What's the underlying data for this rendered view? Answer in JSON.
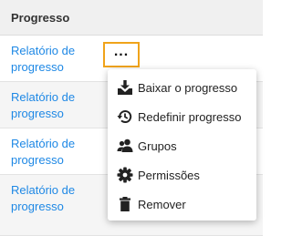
{
  "table": {
    "header": "Progresso",
    "rows": [
      {
        "link": "Relatório de progresso"
      },
      {
        "link": "Relatório de progresso"
      },
      {
        "link": "Relatório de progresso"
      },
      {
        "link": "Relatório de progresso"
      }
    ]
  },
  "actions_button": {
    "label": "..."
  },
  "menu": {
    "items": [
      {
        "label": "Baixar o progresso",
        "icon": "download-tray-icon"
      },
      {
        "label": "Redefinir progresso",
        "icon": "history-icon"
      },
      {
        "label": "Grupos",
        "icon": "users-icon"
      },
      {
        "label": "Permissões",
        "icon": "cog-icon"
      },
      {
        "label": "Remover",
        "icon": "trash-icon"
      }
    ]
  },
  "colors": {
    "link": "#1e88e5",
    "highlight": "#f0a31a",
    "header_bg": "#f0f0f0"
  }
}
